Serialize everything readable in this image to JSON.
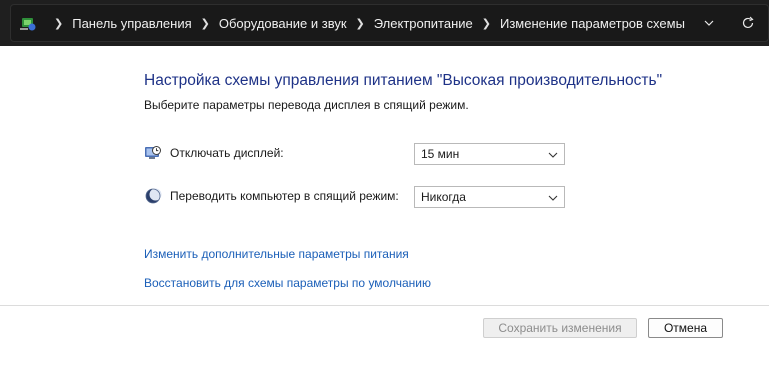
{
  "address_bar": {
    "breadcrumbs": [
      "Панель управления",
      "Оборудование и звук",
      "Электропитание",
      "Изменение параметров схемы"
    ],
    "icons": {
      "location": "control-panel-icon",
      "dropdown": "chevron-down-icon",
      "refresh": "refresh-icon"
    }
  },
  "main": {
    "title": "Настройка схемы управления питанием \"Высокая производительность\"",
    "subtitle": "Выберите параметры перевода дисплея в спящий режим.",
    "settings": [
      {
        "label": "Отключать дисплей:",
        "value": "15 мин",
        "icon": "monitor-clock-icon"
      },
      {
        "label": "Переводить компьютер в спящий режим:",
        "value": "Никогда",
        "icon": "moon-sleep-icon"
      }
    ],
    "links": [
      "Изменить дополнительные параметры питания",
      "Восстановить для схемы параметры по умолчанию"
    ]
  },
  "footer": {
    "save_label": "Сохранить изменения",
    "cancel_label": "Отмена"
  },
  "colors": {
    "title": "#1e3287",
    "link": "#1b5fb8",
    "addressbar_bg": "#1f1f1f"
  }
}
